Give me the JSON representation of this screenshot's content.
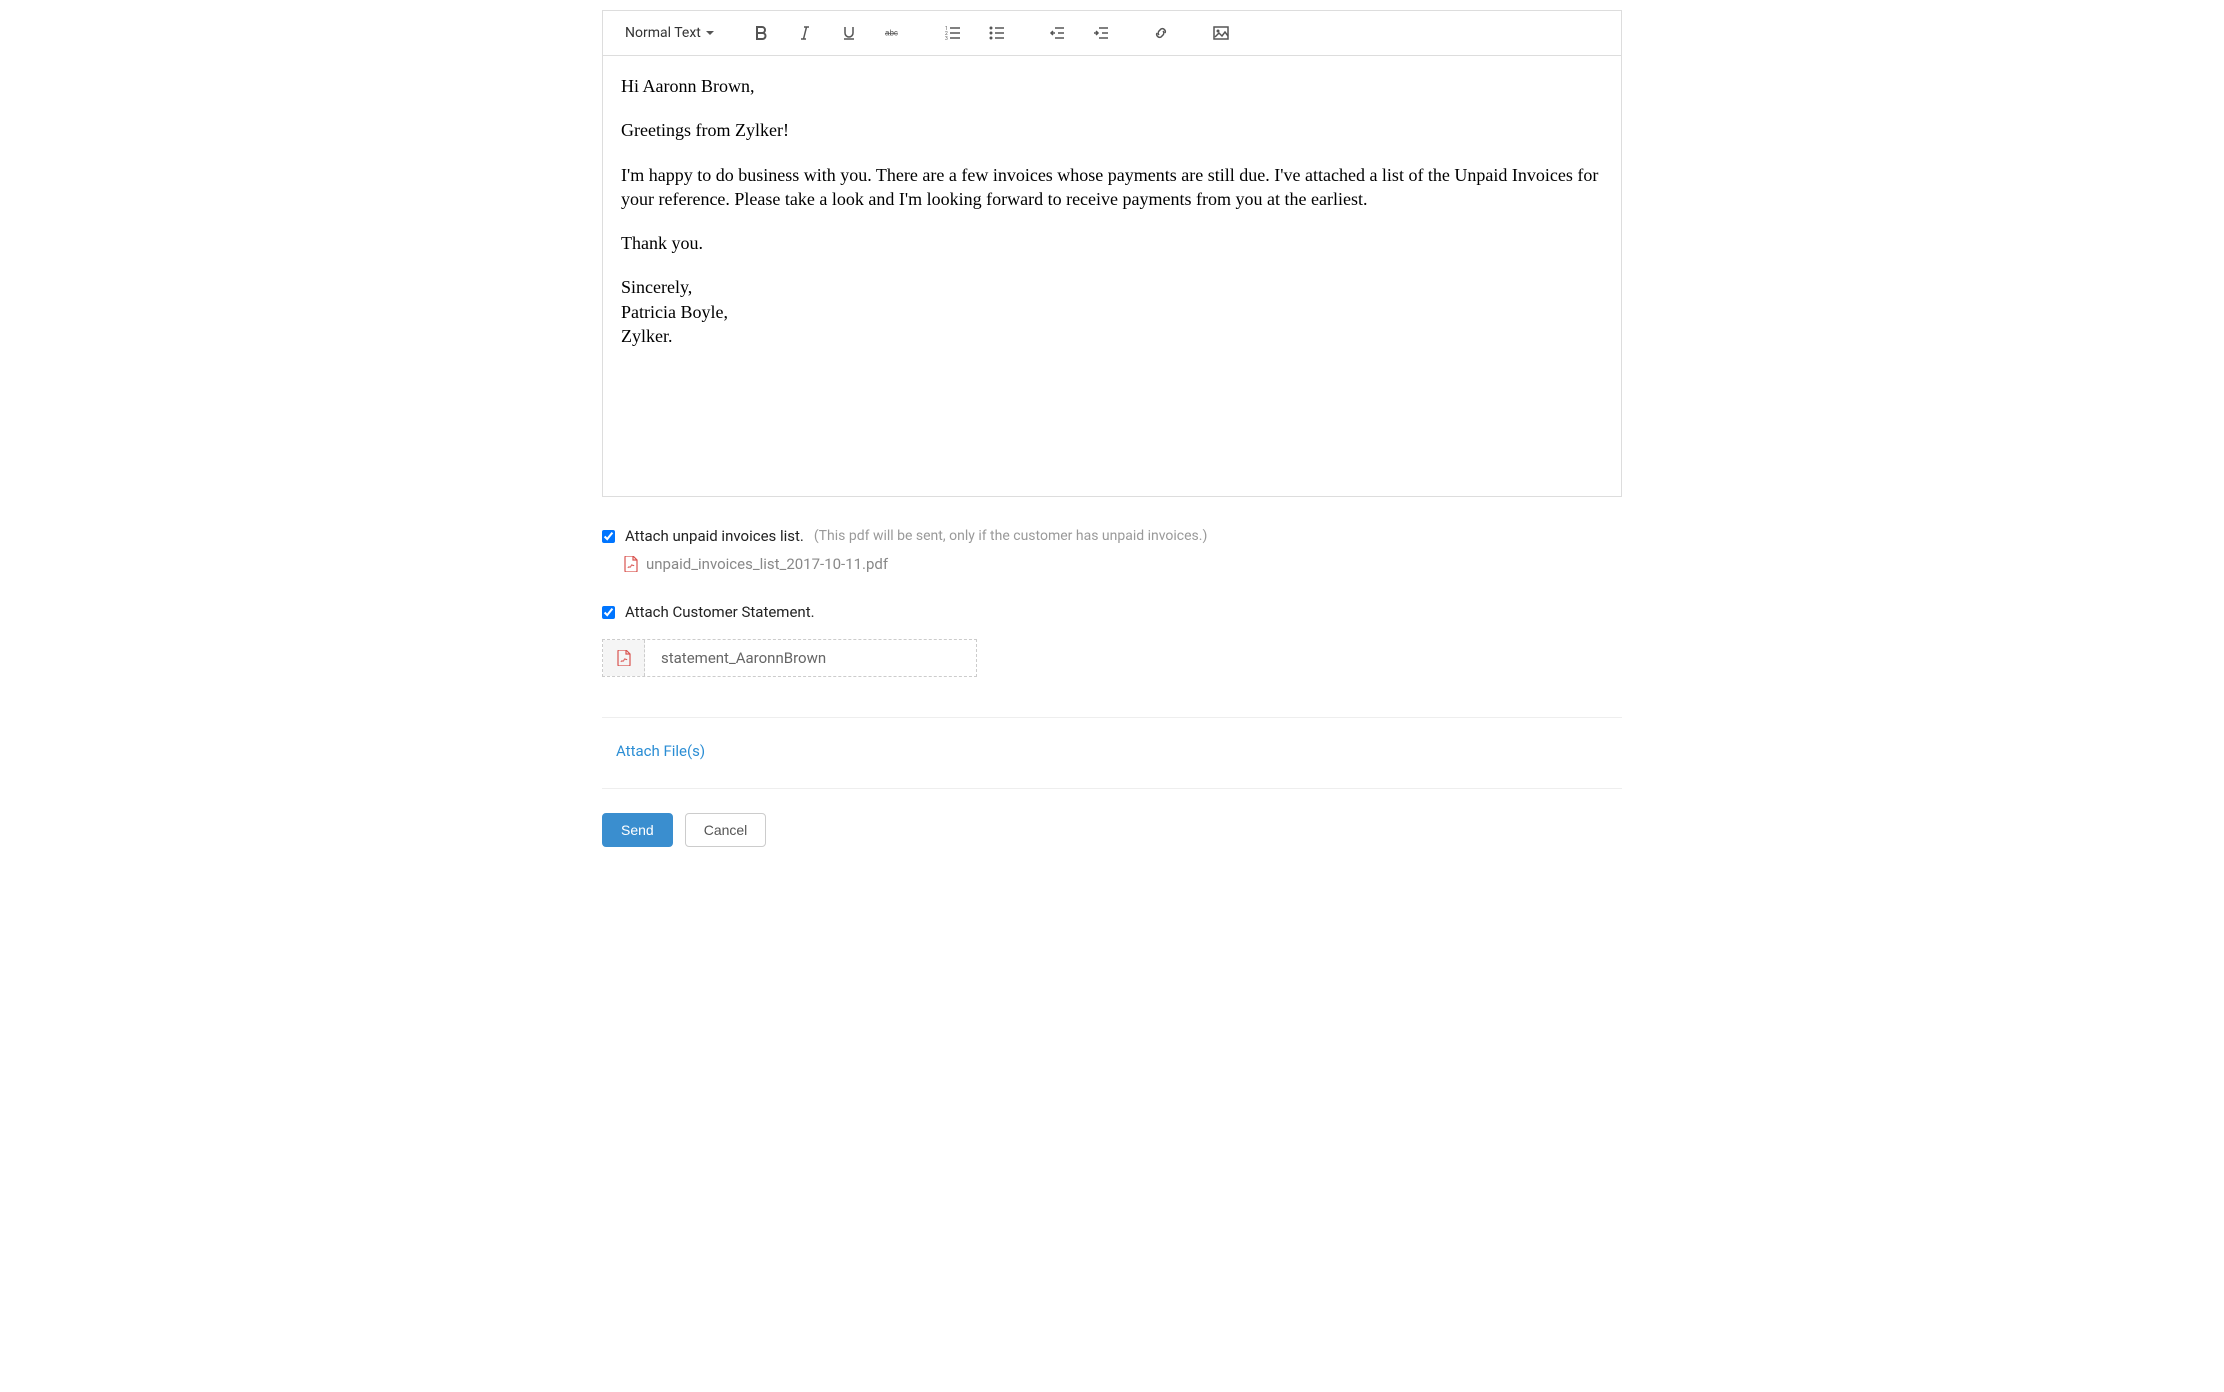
{
  "toolbar": {
    "text_style": "Normal Text"
  },
  "email_body": {
    "greeting": "Hi Aaronn Brown,",
    "line2": "Greetings from Zylker!",
    "line3": "I'm happy to do business with you. There are a few invoices whose payments are still due. I've attached a list of the Unpaid Invoices for your reference. Please take a look and I'm looking forward to receive payments from you at the earliest.",
    "line4": "Thank you.",
    "signoff1": "Sincerely,",
    "signoff2": "Patricia Boyle,",
    "signoff3": "Zylker."
  },
  "attachments": {
    "unpaid_checkbox_label": "Attach unpaid invoices list.",
    "unpaid_hint": "(This pdf will be sent, only if the customer has unpaid invoices.)",
    "unpaid_file": "unpaid_invoices_list_2017-10-11.pdf",
    "statement_checkbox_label": "Attach Customer Statement.",
    "statement_file": "statement_AaronnBrown"
  },
  "actions": {
    "attach_files": "Attach File(s)",
    "send": "Send",
    "cancel": "Cancel"
  }
}
